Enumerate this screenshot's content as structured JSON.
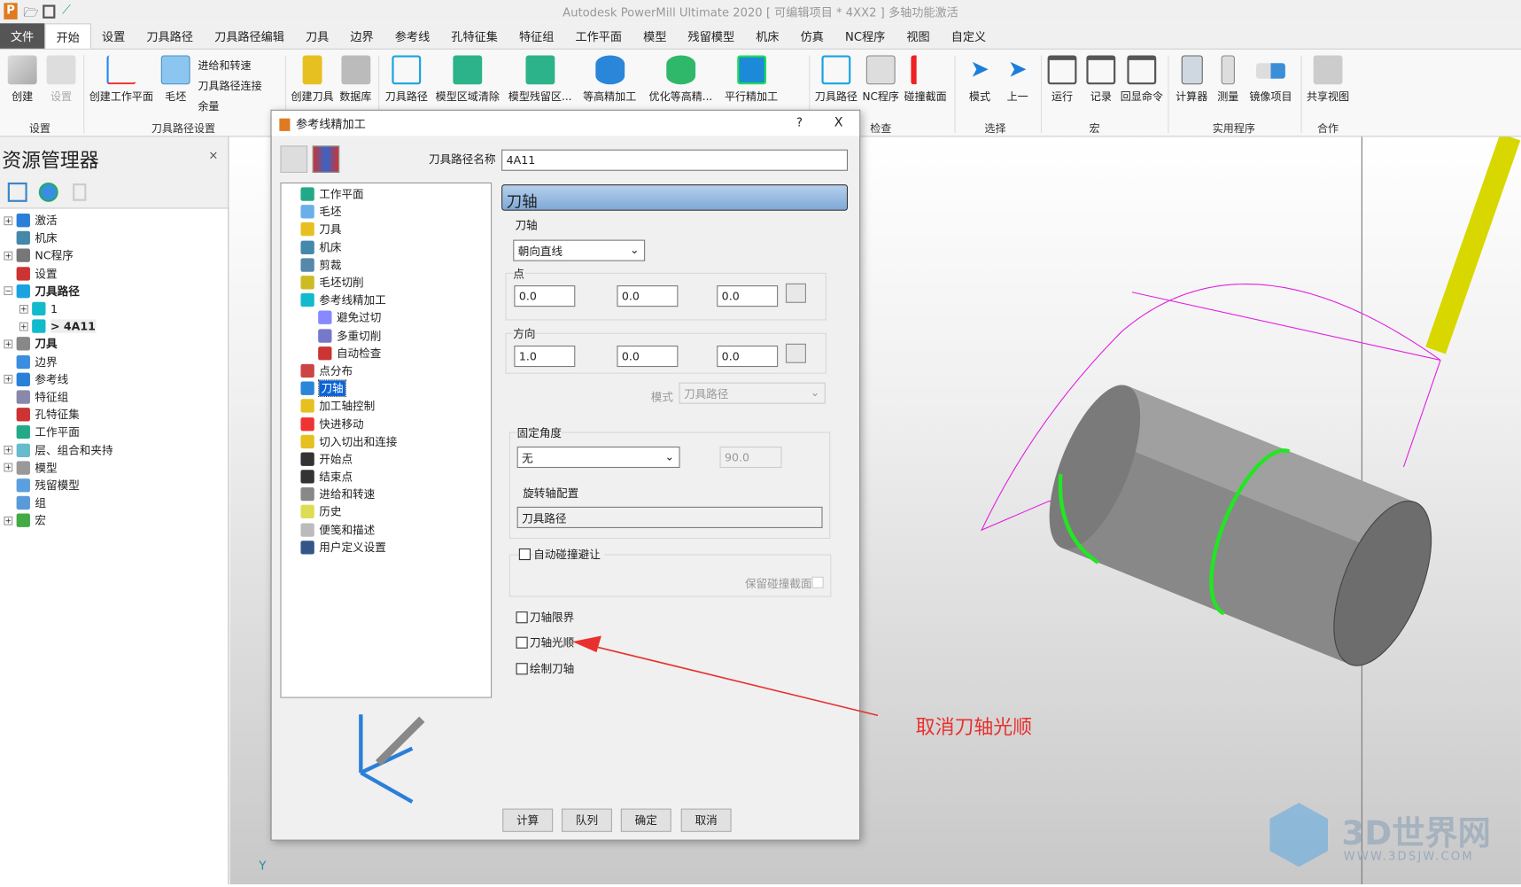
{
  "app": {
    "title": "Autodesk PowerMill Ultimate 2020    [ 可编辑项目 * 4XX2 ]    多轴功能激活"
  },
  "tabs": [
    "文件",
    "开始",
    "设置",
    "刀具路径",
    "刀具路径编辑",
    "刀具",
    "边界",
    "参考线",
    "孔特征集",
    "特征组",
    "工作平面",
    "模型",
    "残留模型",
    "机床",
    "仿真",
    "NC程序",
    "视图",
    "自定义"
  ],
  "ribbon": {
    "buttons": [
      "创建",
      "设置",
      "创建工作平面",
      "毛坯",
      "创建刀具",
      "数据库",
      "刀具路径",
      "模型区域清除",
      "模型残留区...",
      "等高精加工",
      "优化等高精...",
      "平行精加工",
      "刀具路径",
      "NC程序",
      "碰撞截面",
      "模式",
      "上一",
      "运行",
      "记录",
      "回显命令",
      "计算器",
      "测量",
      "镜像项目",
      "共享视图"
    ],
    "small": [
      "进给和转速",
      "刀具路径连接",
      "余量"
    ],
    "groups": [
      "设置",
      "刀具路径设置",
      "检查",
      "选择",
      "宏",
      "实用程序",
      "合作"
    ]
  },
  "explorer": {
    "title": "资源管理器",
    "items": [
      "激活",
      "机床",
      "NC程序",
      "设置",
      "刀具路径",
      "1",
      "> 4A11",
      "刀具",
      "边界",
      "参考线",
      "特征组",
      "孔特征集",
      "工作平面",
      "层、组合和夹持",
      "模型",
      "残留模型",
      "组",
      "宏"
    ]
  },
  "dialog": {
    "title": "参考线精加工",
    "help": "?",
    "close": "X",
    "name_label": "刀具路径名称",
    "name_value": "4A11",
    "tree": [
      "工作平面",
      "毛坯",
      "刀具",
      "机床",
      "剪裁",
      "毛坯切削",
      "参考线精加工",
      "避免过切",
      "多重切削",
      "自动检查",
      "点分布",
      "刀轴",
      "加工轴控制",
      "快进移动",
      "切入切出和连接",
      "开始点",
      "结束点",
      "进给和转速",
      "历史",
      "便笺和描述",
      "用户定义设置"
    ],
    "section": "刀轴",
    "axis_label": "刀轴",
    "axis_value": "朝向直线",
    "point_label": "点",
    "point": [
      "0.0",
      "0.0",
      "0.0"
    ],
    "dir_label": "方向",
    "direction": [
      "1.0",
      "0.0",
      "0.0"
    ],
    "mode_label": "模式",
    "mode_value": "刀具路径",
    "fixed_label": "固定角度",
    "fixed_value": "无",
    "fixed_angle": "90.0",
    "rot_label": "旋转轴配置",
    "rot_value": "刀具路径",
    "auto_collision": "自动碰撞避让",
    "keep_collision": "保留碰撞截面",
    "limits": "刀轴限界",
    "smoothing": "刀轴光顺",
    "draw": "绘制刀轴",
    "buttons": [
      "计算",
      "队列",
      "确定",
      "取消"
    ]
  },
  "annotation": {
    "text": "取消刀轴光顺",
    "color": "#e8312f"
  },
  "watermark": {
    "text": "3D世界网",
    "url_text": "WWW.3DSJW.COM"
  }
}
